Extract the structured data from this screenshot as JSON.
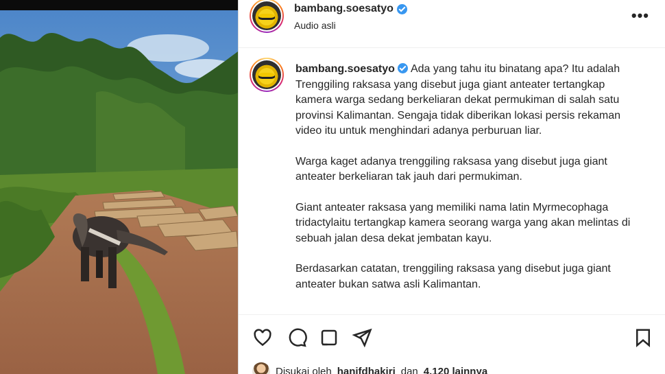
{
  "post": {
    "username": "bambang.soesatyo",
    "subtitle": "Audio asli",
    "more_icon": "more-horizontal-icon",
    "caption_paragraphs": [
      "Ada yang tahu itu binatang apa? Itu adalah Trenggiling raksasa yang disebut juga giant anteater tertangkap kamera warga sedang berkeliaran dekat permukiman di salah satu provinsi Kalimantan. Sengaja tidak diberikan lokasi persis rekaman video itu untuk menghindari adanya perburuan liar.",
      "Warga kaget adanya trenggiling raksasa yang disebut juga giant anteater berkeliaran tak jauh dari permukiman.",
      "Giant anteater raksasa yang memiliki nama latin Myrmecophaga tridactylaitu tertangkap kamera seorang warga yang akan melintas di sebuah jalan desa dekat jembatan kayu.",
      "Berdasarkan catatan, trenggiling raksasa yang disebut juga giant anteater bukan satwa asli Kalimantan."
    ],
    "likes": {
      "prefix": "Disukai oleh",
      "user": "hanifdhakiri",
      "middle": "dan",
      "count": "4.120 lainnya"
    }
  },
  "actions": {
    "icons": [
      "heart-icon",
      "comment-icon",
      "share-icon",
      "send-icon",
      "bookmark-icon"
    ]
  },
  "colors": {
    "verified": "#3897f0",
    "text": "#262626",
    "border": "#dbdbdb"
  }
}
